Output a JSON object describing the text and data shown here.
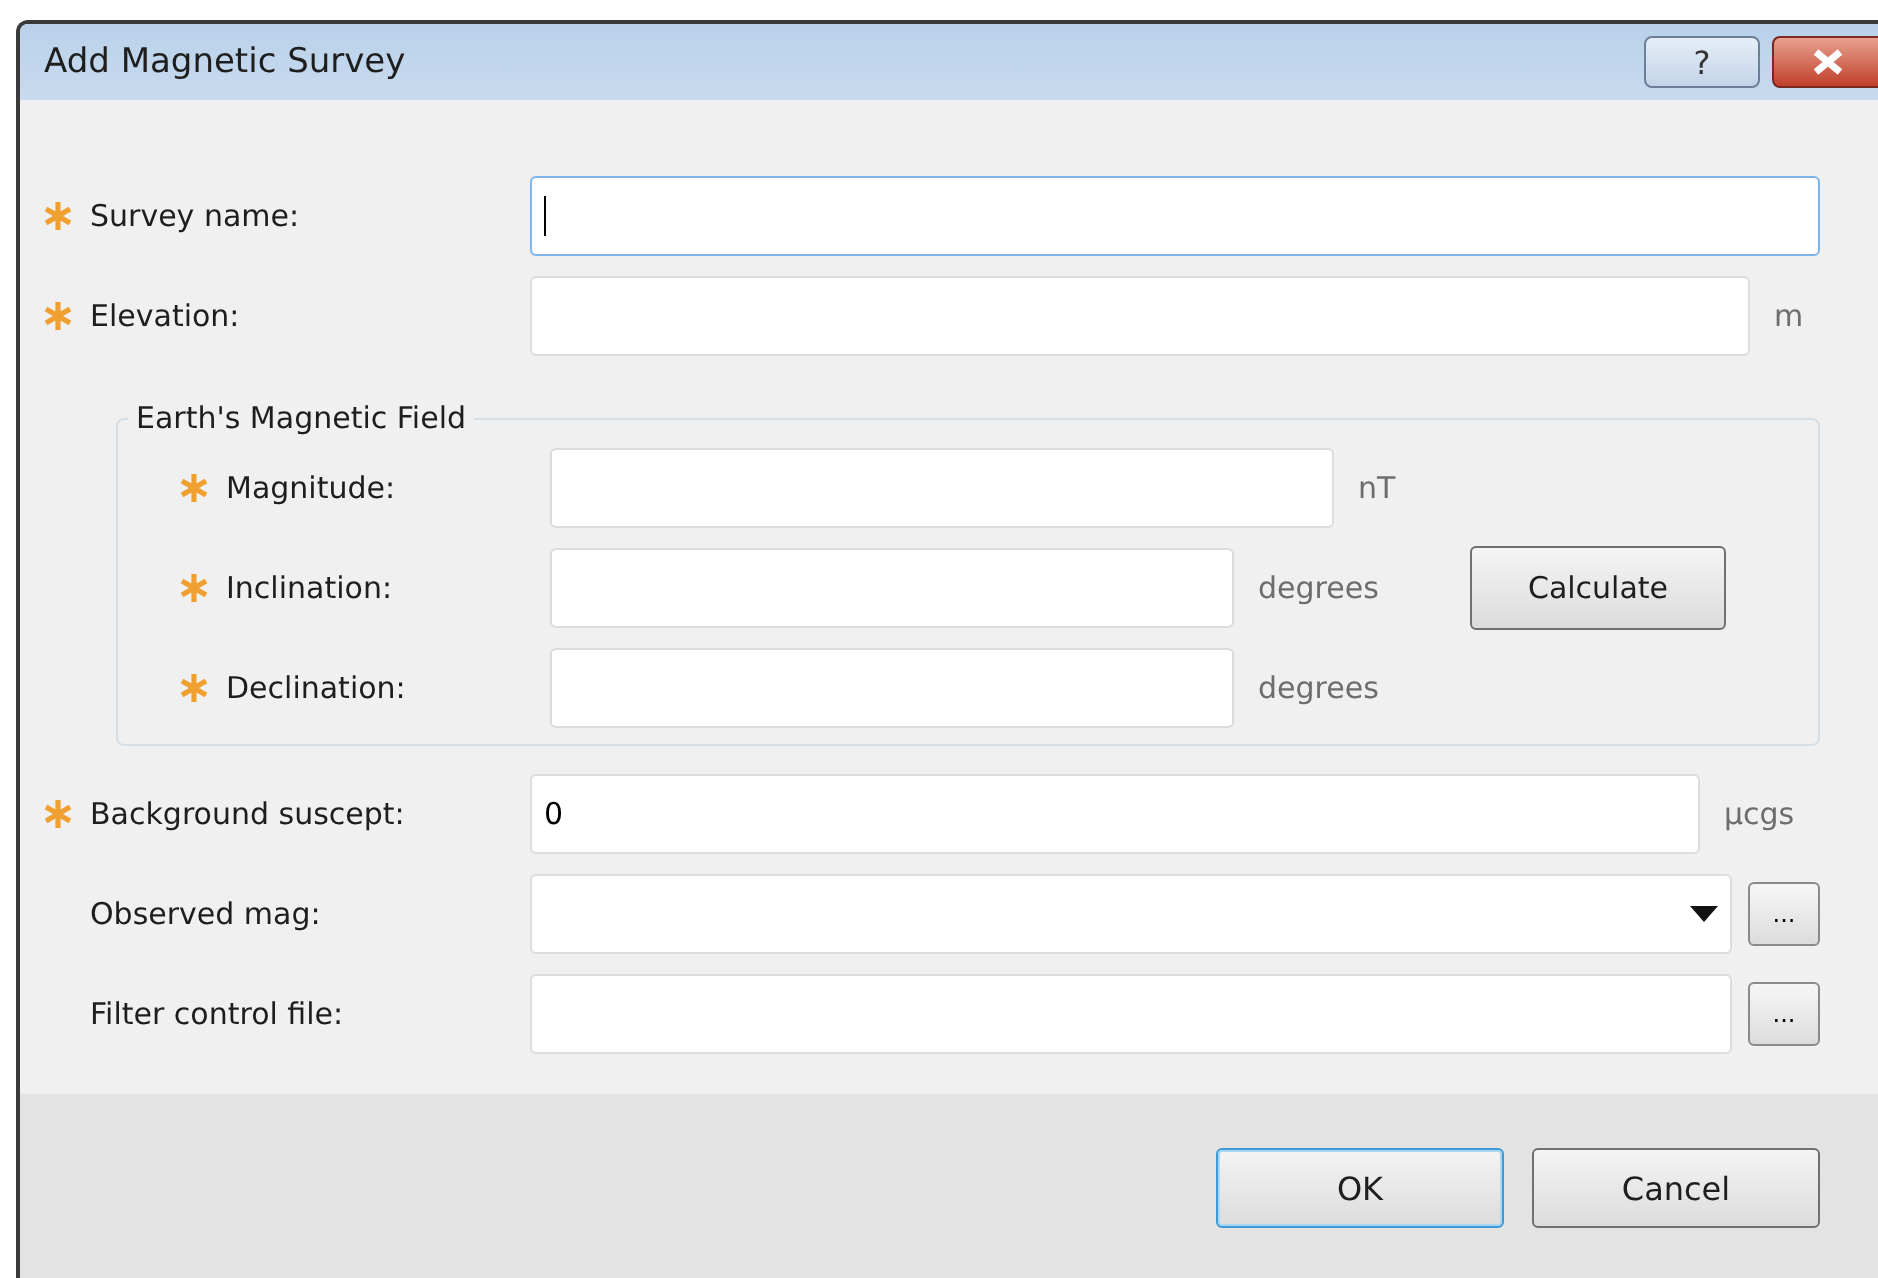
{
  "window": {
    "title": "Add Magnetic Survey",
    "help": "?"
  },
  "fields": [
    {
      "label": "Survey name:",
      "required": true,
      "focused": true
    },
    {
      "label": "Elevation:",
      "required": true,
      "unit": "m",
      "focused": false
    }
  ],
  "group": {
    "title": "Earth's Magnetic Field",
    "fields": [
      {
        "label": "Magnitude:",
        "required": true,
        "unit": "nT"
      },
      {
        "label": "Inclination:",
        "required": true,
        "unit": "degrees"
      },
      {
        "label": "Declination:",
        "required": true,
        "unit": "degrees"
      }
    ],
    "button": "Calculate"
  },
  "more_fields": [
    {
      "label": "Background suscept:",
      "required": true,
      "kind": "text",
      "value": "0",
      "unit": "µcgs",
      "focused": false
    },
    {
      "label": "Observed mag:",
      "required": false,
      "kind": "dropdown",
      "browse": "...",
      "focused": false
    },
    {
      "label": "Filter control file:",
      "required": false,
      "kind": "file",
      "browse": "...",
      "focused": false
    }
  ],
  "buttons": [
    {
      "label": "OK",
      "default": true
    },
    {
      "label": "Cancel",
      "default": false
    }
  ]
}
